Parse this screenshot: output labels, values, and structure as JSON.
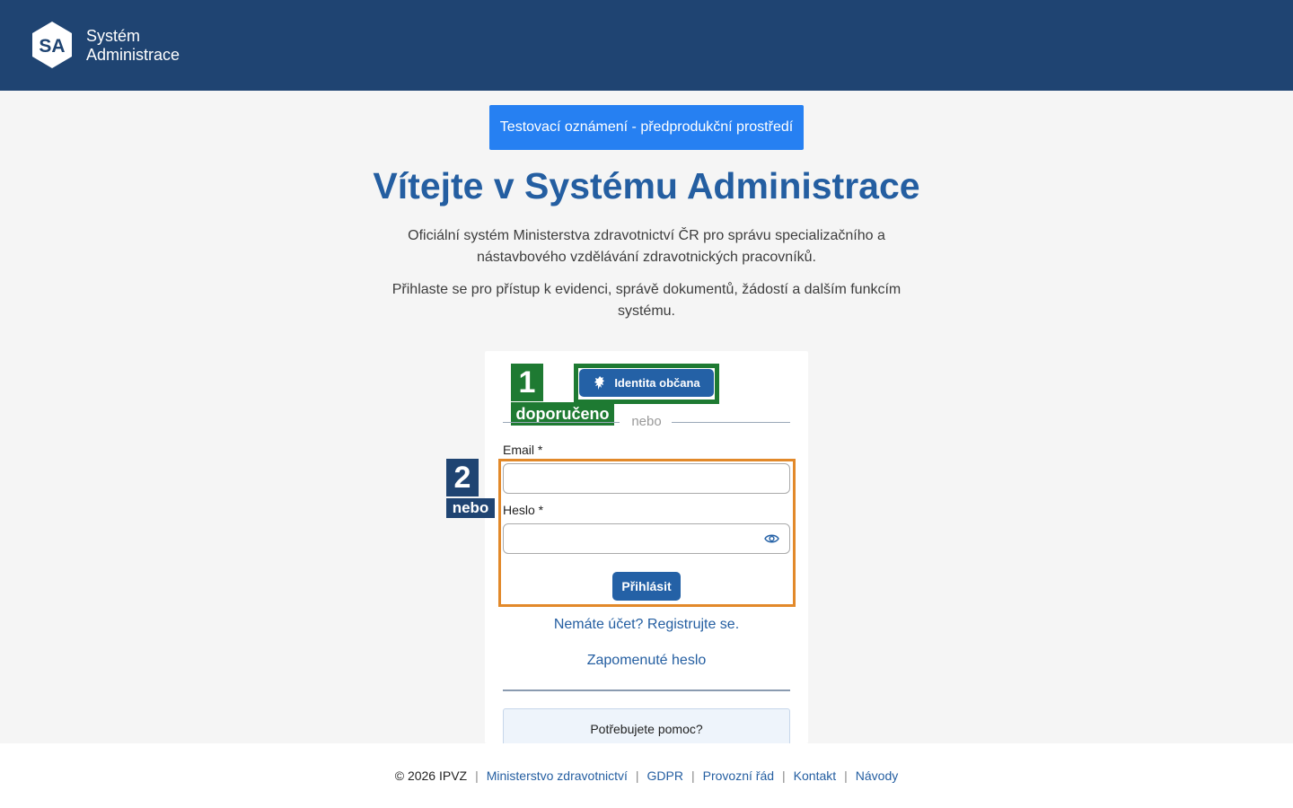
{
  "header": {
    "logo_text": "SA",
    "app_name_line1": "Systém",
    "app_name_line2": "Administrace"
  },
  "announcement": "Testovací oznámení - předprodukční prostředí",
  "main": {
    "title": "Vítejte v Systému Administrace",
    "intro_1": "Oficiální systém Ministerstva zdravotnictví ČR pro správu specializačního a nástavbového vzdělávání zdravotnických pracovníků.",
    "intro_2": "Přihlaste se pro přístup k evidenci, správě dokumentů, žádostí a dalším funkcím systému."
  },
  "login": {
    "badge1_number": "1",
    "badge1_label": "doporučeno",
    "badge2_number": "2",
    "badge2_label": "nebo",
    "identity_button": "Identita občana",
    "divider": "nebo",
    "email_label": "Email *",
    "email_value": "",
    "password_label": "Heslo *",
    "password_value": "",
    "submit": "Přihlásit",
    "register_link": "Nemáte účet? Registrujte se.",
    "forgot_link": "Zapomenuté heslo",
    "help": "Potřebujete pomoc?"
  },
  "footer": {
    "copyright": "© 2026 IPVZ",
    "links": [
      "Ministerstvo zdravotnictví",
      "GDPR",
      "Provozní řád",
      "Kontakt",
      "Návody"
    ]
  },
  "colors": {
    "header_bg": "#1f4472",
    "announcement_bg": "#2680f2",
    "title": "#245ea1",
    "primary_button": "#2461a6",
    "recommended_badge": "#1e7a32",
    "alternative_highlight": "#e2892a"
  },
  "icons": {
    "identity_button": "lion-emblem-icon",
    "password_toggle": "eye-icon"
  }
}
